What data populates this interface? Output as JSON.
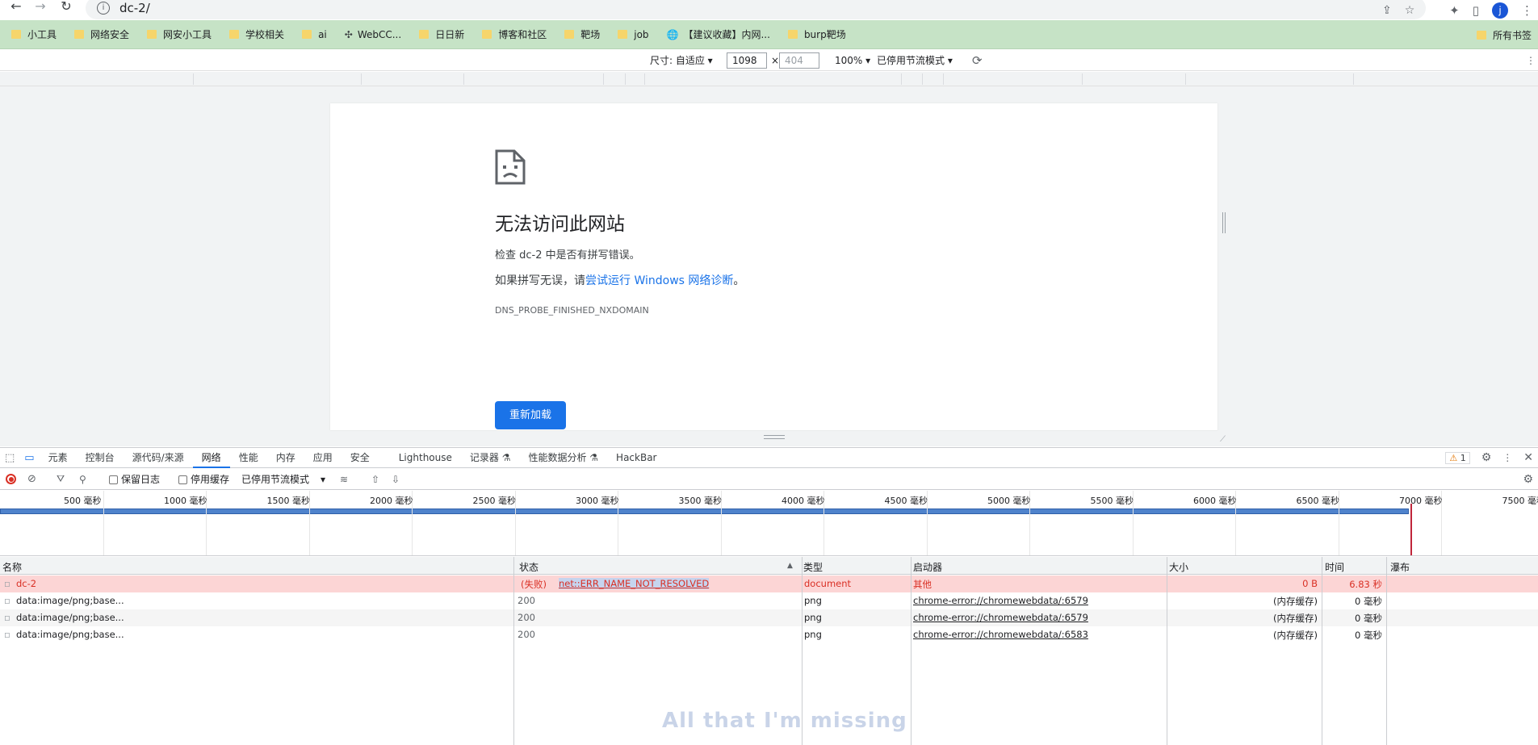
{
  "browser": {
    "url": "dc-2/",
    "avatar_letter": "j"
  },
  "bookmarks": [
    {
      "label": "小工具",
      "icon": "folder-icon"
    },
    {
      "label": "网络安全",
      "icon": "folder-icon"
    },
    {
      "label": "网安小工具",
      "icon": "folder-icon"
    },
    {
      "label": "学校相关",
      "icon": "folder-icon"
    },
    {
      "label": "ai",
      "icon": "folder-icon"
    },
    {
      "label": "WebCC...",
      "icon": "webcc-icon"
    },
    {
      "label": "日日新",
      "icon": "folder-icon"
    },
    {
      "label": "博客和社区",
      "icon": "folder-icon"
    },
    {
      "label": "靶场",
      "icon": "folder-icon"
    },
    {
      "label": "job",
      "icon": "folder-icon"
    },
    {
      "label": "【建议收藏】内网...",
      "icon": "globe-icon"
    },
    {
      "label": "burp靶场",
      "icon": "folder-icon"
    }
  ],
  "bookmarks_right": "所有书签",
  "emulation": {
    "size_label": "尺寸: 自适应 ▾",
    "width": "1098",
    "times": "×",
    "height": "404",
    "zoom": "100% ▾",
    "throttle": "已停用节流模式 ▾"
  },
  "error_page": {
    "title": "无法访问此网站",
    "line1": "检查 dc-2 中是否有拼写错误。",
    "line2_prefix": "如果拼写无误，请",
    "line2_link": "尝试运行 Windows 网络诊断",
    "line2_suffix": "。",
    "code": "DNS_PROBE_FINISHED_NXDOMAIN",
    "reload": "重新加载"
  },
  "devtools": {
    "tabs": [
      "元素",
      "控制台",
      "源代码/来源",
      "网络",
      "性能",
      "内存",
      "应用",
      "安全",
      "Lighthouse",
      "记录器 ⚗",
      "性能数据分析 ⚗",
      "HackBar"
    ],
    "active_tab": "网络",
    "warning_count": "1",
    "toolbar": {
      "preserve_log": "保留日志",
      "disable_cache": "停用缓存",
      "throttle": "已停用节流模式"
    },
    "ticks": [
      "500 毫秒",
      "1000 毫秒",
      "1500 毫秒",
      "2000 毫秒",
      "2500 毫秒",
      "3000 毫秒",
      "3500 毫秒",
      "4000 毫秒",
      "4500 毫秒",
      "5000 毫秒",
      "5500 毫秒",
      "6000 毫秒",
      "6500 毫秒",
      "7000 毫秒",
      "7500 毫秒"
    ],
    "columns": {
      "name": "名称",
      "status": "状态",
      "type": "类型",
      "initiator": "启动器",
      "size": "大小",
      "time": "时间",
      "waterfall": "瀑布"
    },
    "rows": [
      {
        "name": "dc-2",
        "status_prefix": "(失败)",
        "status": "net::ERR_NAME_NOT_RESOLVED",
        "type": "document",
        "initiator": "其他",
        "size": "0 B",
        "time": "6.83 秒"
      },
      {
        "name": "data:image/png;base...",
        "status_prefix": "",
        "status": "200",
        "type": "png",
        "initiator": "chrome-error://chromewebdata/:6579",
        "size": "(内存缓存)",
        "time": "0 毫秒"
      },
      {
        "name": "data:image/png;base...",
        "status_prefix": "",
        "status": "200",
        "type": "png",
        "initiator": "chrome-error://chromewebdata/:6579",
        "size": "(内存缓存)",
        "time": "0 毫秒"
      },
      {
        "name": "data:image/png;base...",
        "status_prefix": "",
        "status": "200",
        "type": "png",
        "initiator": "chrome-error://chromewebdata/:6583",
        "size": "(内存缓存)",
        "time": "0 毫秒"
      }
    ],
    "watermark": "All that I'm missing"
  }
}
